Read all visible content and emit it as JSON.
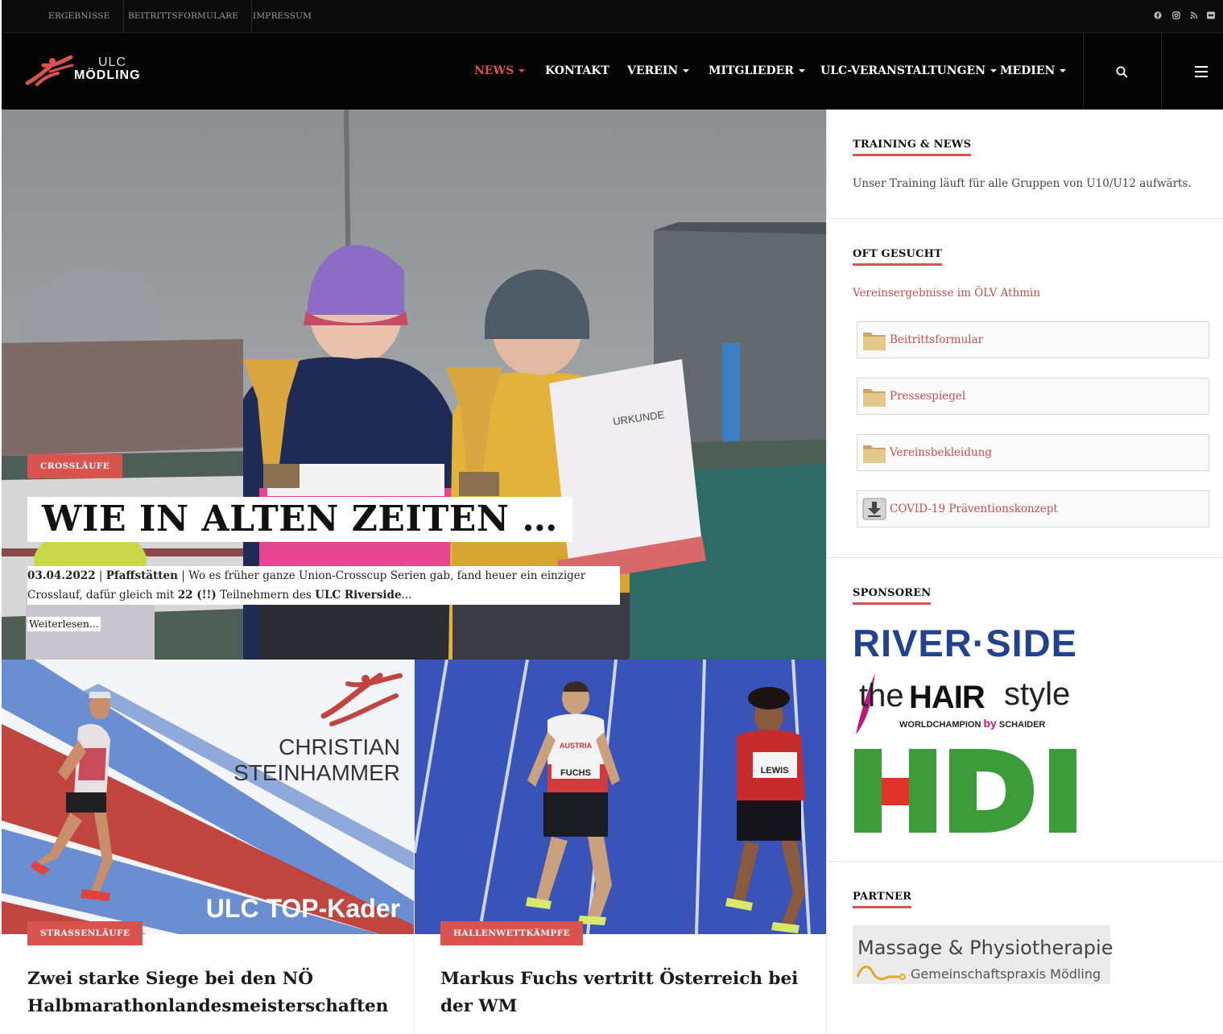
{
  "topbar": {
    "links": [
      "ERGEBNISSE",
      "BEITRITTSFORMULARE",
      "IMPRESSUM"
    ],
    "social_icons": [
      "facebook-icon",
      "instagram-icon",
      "rss-icon",
      "flickr-icon"
    ]
  },
  "logo": {
    "line1": "ULC",
    "line2": "MÖDLING"
  },
  "nav": {
    "items": [
      {
        "label": "NEWS",
        "dropdown": true,
        "active": true
      },
      {
        "label": "KONTAKT",
        "dropdown": false,
        "active": false
      },
      {
        "label": "VEREIN",
        "dropdown": true,
        "active": false
      },
      {
        "label": "MITGLIEDER",
        "dropdown": true,
        "active": false
      },
      {
        "label": "ULC-VERANSTALTUNGEN",
        "dropdown": true,
        "active": false
      },
      {
        "label": "MEDIEN",
        "dropdown": true,
        "active": false
      }
    ],
    "search_icon": "search-icon",
    "menu_icon": "hamburger-icon"
  },
  "hero": {
    "category": "CROSSLÄUFE",
    "title": "WIE IN ALTEN ZEITEN …",
    "date": "03.04.2022",
    "separator": " | ",
    "location": "Pfaffstätten",
    "excerpt_part1": "Wo es früher ganze Union-Crosscup Serien gab, fand heuer ein einziger Crosslauf, dafür gleich mit ",
    "excerpt_bold1": "22 (!!)",
    "excerpt_part2": " Teilnehmern des ",
    "excerpt_bold2": "ULC Riverside",
    "excerpt_end": "...",
    "read_more": "Weiterlesen...",
    "certificate_text": "URKUNDE"
  },
  "cards": [
    {
      "category": "STRASSENLÄUFE",
      "title": "Zwei starke Siege bei den NÖ Halbmarathonlandesmeisterschaften",
      "image_text1": "CHRISTIAN",
      "image_text2": "STEINHAMMER",
      "image_text3": "ULC TOP-Kader"
    },
    {
      "category": "HALLENWETTKÄMPFE",
      "title": "Markus Fuchs vertritt Österreich bei der WM",
      "bib1": "FUCHS",
      "bib2": "LEWIS",
      "shirt_text": "AUSTRIA"
    }
  ],
  "sidebar": {
    "training": {
      "title": "TRAINING & NEWS",
      "text": "Unser Training läuft für alle Gruppen von U10/U12 aufwärts."
    },
    "oft_gesucht": {
      "title": "OFT GESUCHT",
      "link": "Vereinsergebnisse im ÖLV Athmin",
      "files": [
        {
          "label": "Beitrittsformular",
          "icon": "folder-icon"
        },
        {
          "label": "Pressespiegel",
          "icon": "folder-icon"
        },
        {
          "label": "Vereinsbekleidung",
          "icon": "folder-icon"
        },
        {
          "label": "COVID-19 Präventionskonzept",
          "icon": "download-icon"
        }
      ]
    },
    "sponsoren": {
      "title": "SPONSOREN",
      "riverside": "RIVER·SIDE",
      "hair_the": "the",
      "hair_main": "HAIR",
      "hair_style": "style",
      "hair_sub1": "WORLDCHAMPION",
      "hair_by": "by",
      "hair_sub2": "SCHAIDER",
      "hdi": "HDI"
    },
    "partner": {
      "title": "PARTNER",
      "line1": "Massage & Physiotherapie",
      "line2": "Gemeinschaftspraxis Mödling"
    }
  },
  "colors": {
    "accent": "#d9534f",
    "dark": "#050505",
    "riverside_blue": "#22418f",
    "hdi_green": "#3d9c3a"
  }
}
